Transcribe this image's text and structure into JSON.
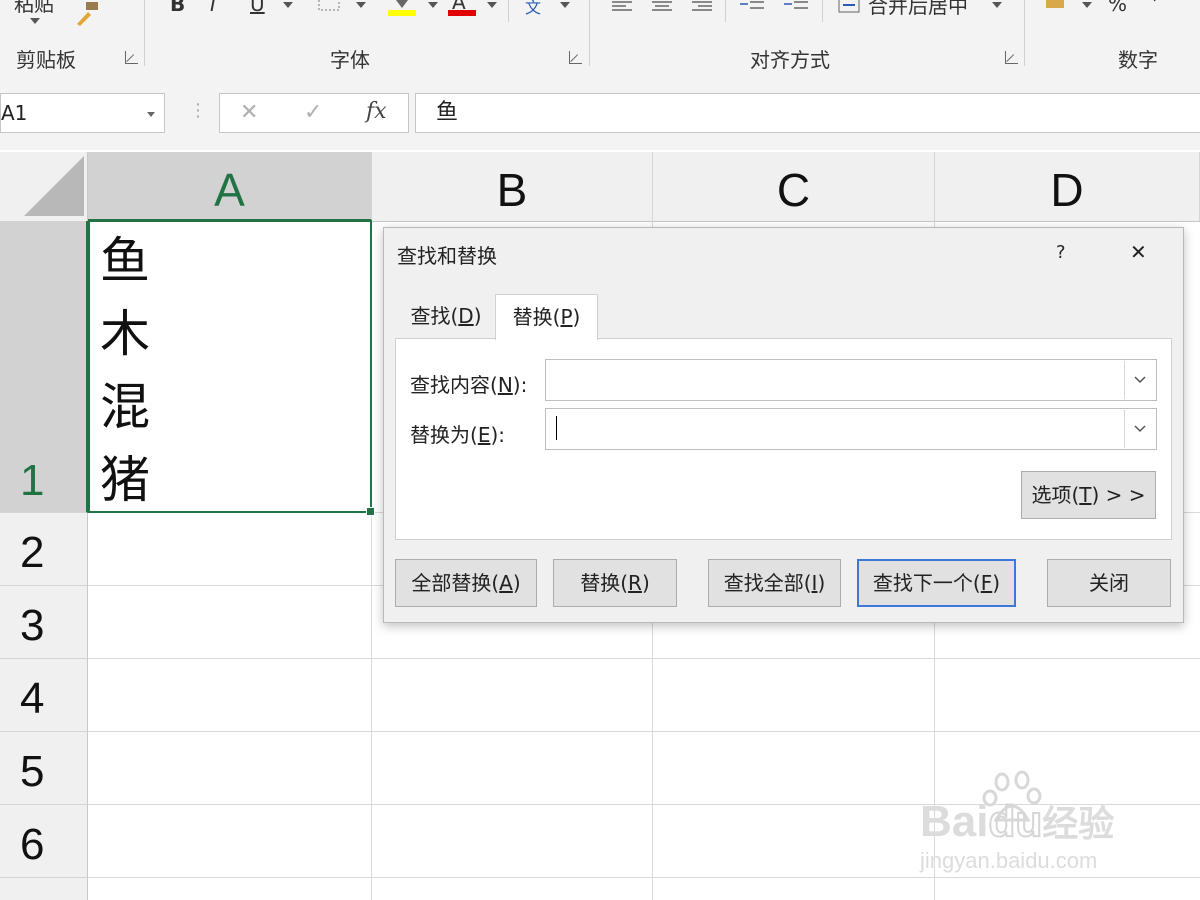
{
  "ribbon": {
    "partial_labels": {
      "paste_cut": "粘贴",
      "merge": "合并后居中",
      "percent": "%"
    },
    "groups": [
      "剪贴板",
      "字体",
      "对齐方式",
      "数字"
    ],
    "font_letters": {
      "bold": "B",
      "italic": "I",
      "underline": "U",
      "font_color": "A",
      "wen": "文"
    }
  },
  "formula_bar": {
    "name_box": "A1",
    "cancel": "✕",
    "enter": "✓",
    "fx": "fx",
    "content": "鱼"
  },
  "sheet": {
    "columns": [
      "A",
      "B",
      "C",
      "D"
    ],
    "rows": [
      "1",
      "2",
      "3",
      "4",
      "5",
      "6"
    ],
    "cell_a1_lines": [
      "鱼",
      "木",
      "混",
      "猪"
    ]
  },
  "dialog": {
    "title": "查找和替换",
    "help": "?",
    "close": "✕",
    "tabs": [
      {
        "label": "查找(",
        "key": "D",
        "end": ")"
      },
      {
        "label": "替换(",
        "key": "P",
        "end": ")"
      }
    ],
    "find_label": {
      "text": "查找内容(",
      "key": "N",
      "end": "):"
    },
    "replace_label": {
      "text": "替换为(",
      "key": "E",
      "end": "):"
    },
    "find_value": "",
    "replace_value": "",
    "options_btn": {
      "text": "选项(",
      "key": "T",
      "end": ") > >"
    },
    "buttons": [
      {
        "text": "全部替换(",
        "key": "A",
        "end": ")"
      },
      {
        "text": "替换(",
        "key": "R",
        "end": ")"
      },
      {
        "text": "查找全部(",
        "key": "I",
        "end": ")"
      },
      {
        "text": "查找下一个(",
        "key": "F",
        "end": ")"
      },
      {
        "text": "关闭",
        "key": "",
        "end": ""
      }
    ]
  },
  "watermark": {
    "brand": "Bai",
    "brand2": "du",
    "cn": "经验",
    "url": "jingyan.baidu.com"
  }
}
